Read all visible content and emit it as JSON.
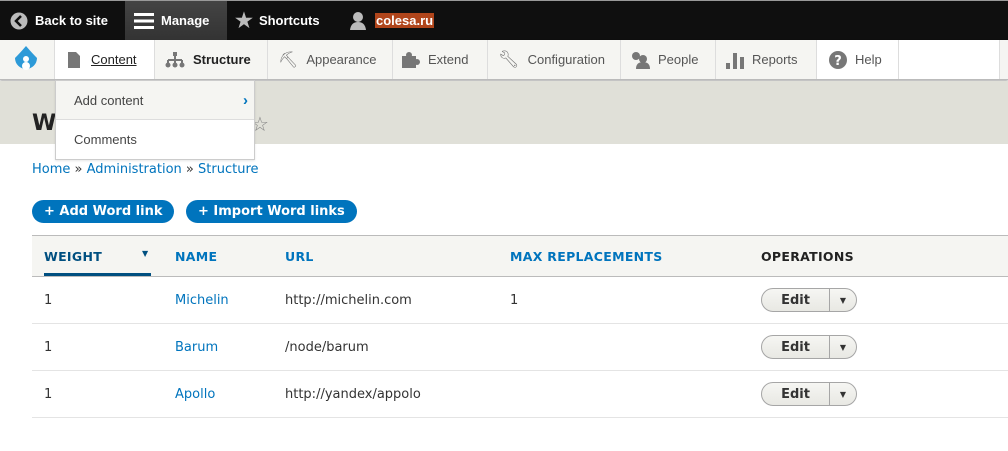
{
  "toolbar": {
    "back": "Back to site",
    "manage": "Manage",
    "shortcuts": "Shortcuts",
    "user": "colesa.ru"
  },
  "nav": {
    "content": "Content",
    "structure": "Structure",
    "appearance": "Appearance",
    "extend": "Extend",
    "configuration": "Configuration",
    "people": "People",
    "reports": "Reports",
    "help": "Help"
  },
  "dropdown": {
    "add_content": "Add content",
    "comments": "Comments"
  },
  "page": {
    "title": "W"
  },
  "breadcrumb": {
    "home": "Home",
    "admin": "Administration",
    "structure": "Structure",
    "sep": "»"
  },
  "actions": {
    "add": "+ Add Word link",
    "import": "+ Import Word links"
  },
  "table": {
    "headers": [
      "WEIGHT",
      "NAME",
      "URL",
      "MAX REPLACEMENTS",
      "OPERATIONS"
    ],
    "rows": [
      {
        "weight": "1",
        "name": "Michelin",
        "url": "http://michelin.com",
        "max": "1",
        "op": "Edit"
      },
      {
        "weight": "1",
        "name": "Barum",
        "url": "/node/barum",
        "max": "",
        "op": "Edit"
      },
      {
        "weight": "1",
        "name": "Apollo",
        "url": "http://yandex/appolo",
        "max": "",
        "op": "Edit"
      }
    ]
  },
  "colors": {
    "accent": "#0074bd",
    "toolbar": "#0f0f0f",
    "user_highlight": "#b0451b"
  }
}
